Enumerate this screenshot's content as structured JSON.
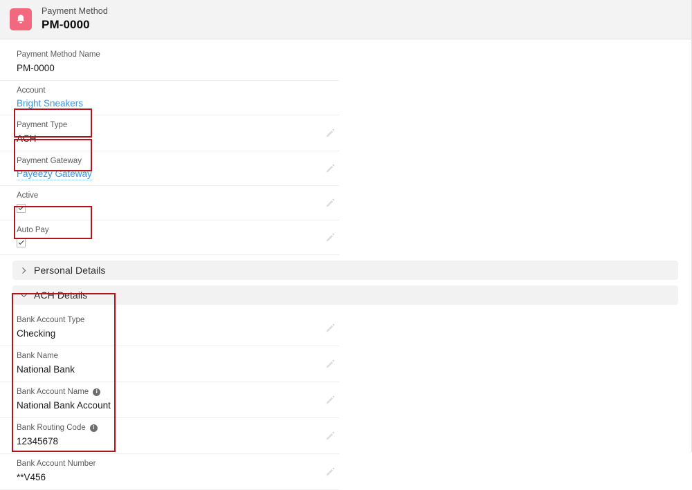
{
  "header": {
    "icon": "bell-icon",
    "object_label": "Payment Method",
    "record_name": "PM-0000",
    "icon_color": "#f2687f"
  },
  "colors": {
    "accent_pink": "#f2687f",
    "link_blue": "#3a91dc",
    "annotation_red": "#b3131c",
    "section_bg": "#f2f2f2",
    "header_bg": "#f3f3f3"
  },
  "main_fields": [
    {
      "label": "Payment Method Name",
      "value": "PM-0000",
      "type": "text",
      "editable": false,
      "highlighted": false
    },
    {
      "label": "Account",
      "value": "Bright Sneakers",
      "type": "link",
      "editable": false,
      "highlighted": false
    },
    {
      "label": "Payment Type",
      "value": "ACH",
      "type": "text",
      "editable": true,
      "highlighted": true
    },
    {
      "label": "Payment Gateway",
      "value": "Payeezy Gateway",
      "type": "link",
      "editable": true,
      "highlighted": true
    },
    {
      "label": "Active",
      "value": "checked",
      "type": "checkbox",
      "editable": true,
      "highlighted": false
    },
    {
      "label": "Auto Pay",
      "value": "checked",
      "type": "checkbox",
      "editable": true,
      "highlighted": true
    }
  ],
  "sections": [
    {
      "title": "Personal Details",
      "expanded": false,
      "chevron": "chevron-right-icon"
    },
    {
      "title": "ACH Details",
      "expanded": true,
      "chevron": "chevron-down-icon"
    }
  ],
  "ach_fields": [
    {
      "label": "Bank Account Type",
      "value": "Checking",
      "info": false,
      "editable": true
    },
    {
      "label": "Bank Name",
      "value": "National Bank",
      "info": false,
      "editable": true
    },
    {
      "label": "Bank Account Name",
      "value": "National Bank Account",
      "info": true,
      "editable": true
    },
    {
      "label": "Bank Routing Code",
      "value": "12345678",
      "info": true,
      "editable": true
    },
    {
      "label": "Bank Account Number",
      "value": "**V456",
      "info": false,
      "editable": true
    }
  ],
  "icons": {
    "info": "i",
    "edit": "pencil-icon",
    "check": "checkmark-icon"
  }
}
